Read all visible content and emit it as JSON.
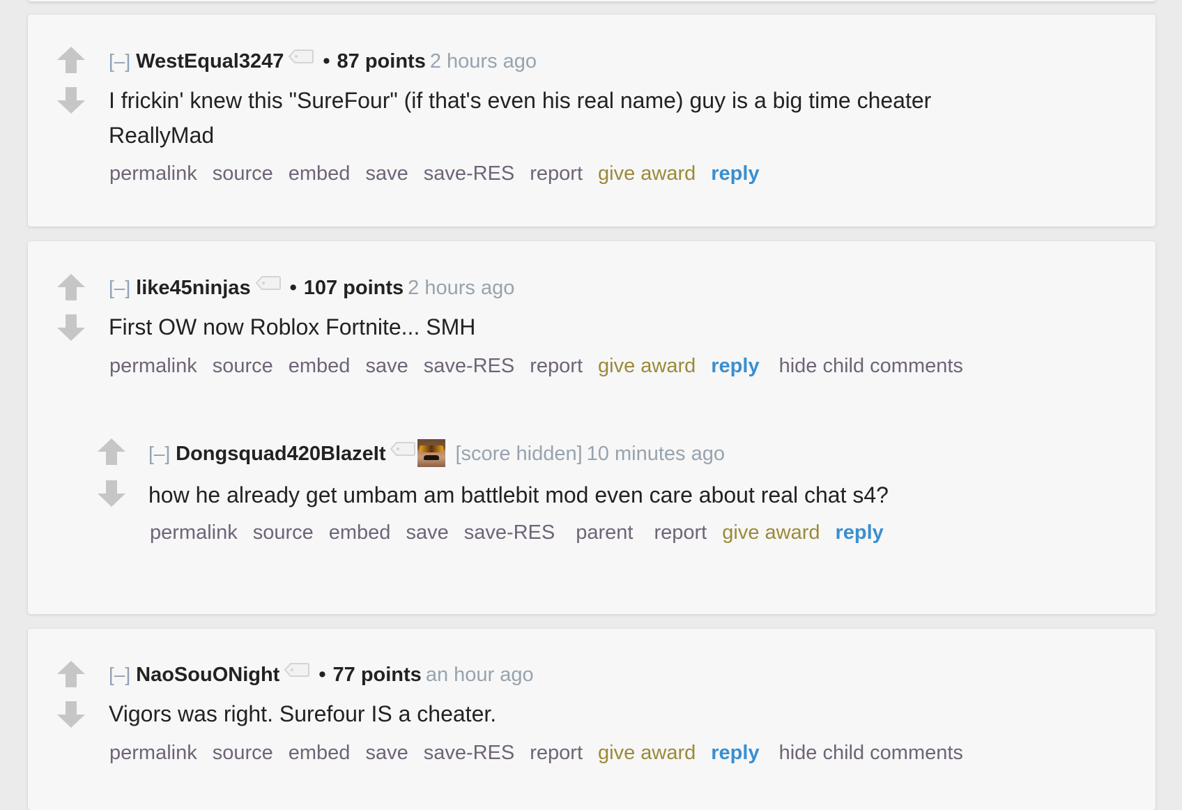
{
  "colors": {
    "page_bg": "#ebebeb",
    "card_bg": "#f7f7f7",
    "link": "#6e6478",
    "award_link": "#9a8a3a",
    "reply_link": "#3a8fcf",
    "timestamp": "#97a3ae",
    "arrow": "#c6c6c6"
  },
  "comments": [
    {
      "expand": "[–]",
      "author": "WestEqual3247",
      "author_tag_icon": "tag-icon",
      "bullet": "•",
      "score": "87 points",
      "time": "2 hours ago",
      "body_lines": [
        "I frickin' knew this \"SureFour\" (if that's even his real name) guy is a big time cheater",
        "ReallyMad"
      ],
      "links": [
        "permalink",
        "source",
        "embed",
        "save",
        "save-RES",
        "report"
      ],
      "award": "give award",
      "reply": "reply"
    },
    {
      "expand": "[–]",
      "author": "like45ninjas",
      "author_tag_icon": "tag-icon",
      "bullet": "•",
      "score": "107 points",
      "time": "2 hours ago",
      "body_lines": [
        "First OW now Roblox Fortnite... SMH"
      ],
      "links": [
        "permalink",
        "source",
        "embed",
        "save",
        "save-RES",
        "report"
      ],
      "award": "give award",
      "reply": "reply",
      "hide_children": "hide child comments",
      "children": [
        {
          "expand": "[–]",
          "author": "Dongsquad420BlazeIt",
          "author_tag_icon": "tag-icon",
          "avatar": "user-avatar-image",
          "score_hidden": "[score hidden]",
          "time": "10 minutes ago",
          "body_lines": [
            "how he already get umbam am battlebit mod even care about real chat s4?"
          ],
          "links": [
            "permalink",
            "source",
            "embed",
            "save",
            "save-RES",
            "parent",
            "report"
          ],
          "award": "give award",
          "reply": "reply"
        }
      ]
    },
    {
      "expand": "[–]",
      "author": "NaoSouONight",
      "author_tag_icon": "tag-icon",
      "bullet": "•",
      "score": "77 points",
      "time": "an hour ago",
      "body_lines": [
        "Vigors was right. Surefour IS a cheater."
      ],
      "links": [
        "permalink",
        "source",
        "embed",
        "save",
        "save-RES",
        "report"
      ],
      "award": "give award",
      "reply": "reply",
      "hide_children": "hide child comments"
    }
  ]
}
